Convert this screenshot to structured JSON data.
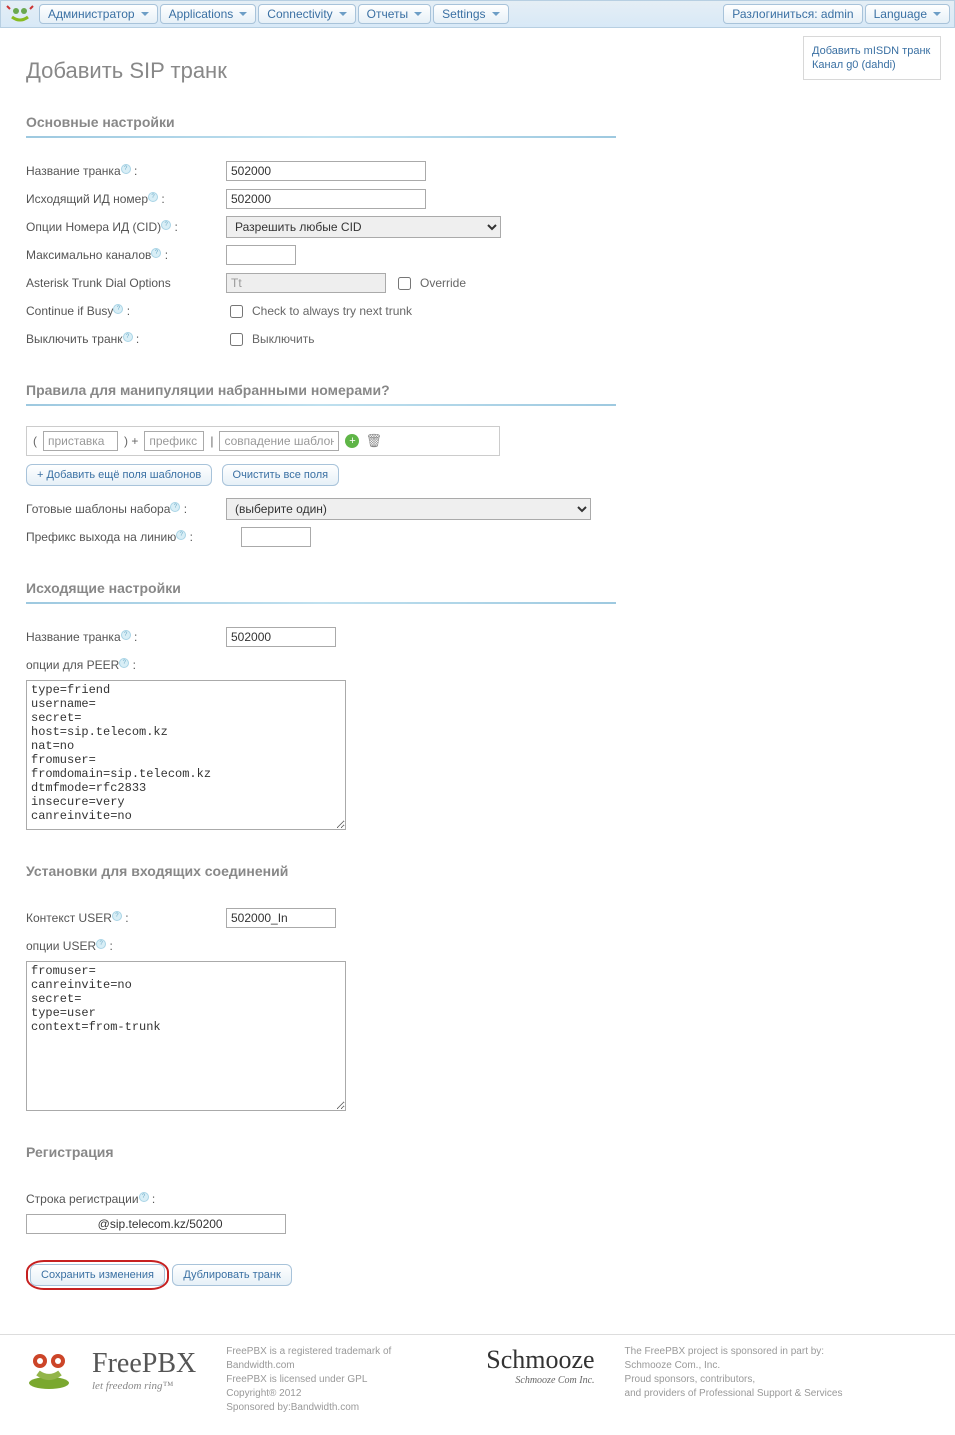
{
  "nav": {
    "admin": "Администратор",
    "apps": "Applications",
    "conn": "Connectivity",
    "reports": "Отчеты",
    "settings": "Settings",
    "logout": "Разлогиниться: admin",
    "language": "Language"
  },
  "side": {
    "misdn": "Добавить mISDN транк",
    "dahdi": "Канал g0 (dahdi)"
  },
  "page": {
    "title": "Добавить SIP транк"
  },
  "sections": {
    "general": "Основные настройки",
    "dialrules": "Правила для манипуляции набранными номерами",
    "outgoing": "Исходящие настройки",
    "incoming": "Установки для входящих соединений",
    "registration": "Регистрация"
  },
  "labels": {
    "trunk_name": "Название транка",
    "outgoing_cid": "Исходящий ИД номер",
    "cid_options": "Опции Номера ИД (CID)",
    "max_channels": "Максимально каналов",
    "dial_options": "Asterisk Trunk Dial Options",
    "override": "Override",
    "continue_busy": "Continue if Busy",
    "continue_busy_chk": "Check to always try next trunk",
    "disable_trunk": "Выключить транк",
    "disable_chk": "Выключить",
    "add_more": "+ Добавить ещё поля шаблонов",
    "clear_all": "Очистить все поля",
    "ready_templates": "Готовые шаблоны набора",
    "out_prefix": "Префикс выхода на линию",
    "trunk_name2": "Название транка",
    "peer_options": "опции для PEER",
    "user_context": "Контекст USER",
    "user_options": "опции USER",
    "reg_string": "Строка регистрации",
    "save": "Сохранить изменения",
    "duplicate": "Дублировать транк"
  },
  "values": {
    "trunk_name": "502000",
    "outgoing_cid": "502000",
    "cid_option_selected": "Разрешить любые CID",
    "max_channels": "",
    "dial_options": "Tt",
    "dial_prepend": "приставка",
    "dial_prefix": "префикс",
    "dial_match": "совпадение шаблона",
    "template_selected": "(выберите один)",
    "out_prefix": "",
    "trunk_name2": "502000",
    "peer_details": "type=friend\nusername=\nsecret=\nhost=sip.telecom.kz\nnat=no\nfromuser=\nfromdomain=sip.telecom.kz\ndtmfmode=rfc2833\ninsecure=very\ncanreinvite=no",
    "user_context": "502000_In",
    "user_details": "fromuser=\ncanreinvite=no\nsecret=\ntype=user\ncontext=from-trunk",
    "reg_string": "                    @sip.telecom.kz/50200"
  },
  "footer": {
    "brand1": "FreePBX",
    "brand1_sub": "let freedom ring™",
    "mid1": "FreePBX is a registered trademark of Bandwidth.com",
    "mid2": "FreePBX is licensed under GPL",
    "mid3": "Copyright® 2012",
    "mid4": "Sponsored by:Bandwidth.com",
    "brand2": "Schmooze",
    "brand2_sub": "Schmooze Com Inc.",
    "r1": "The FreePBX project is sponsored in part by:",
    "r2": "Schmooze Com., Inc.",
    "r3": "Proud sponsors, contributors,",
    "r4": "and providers of Professional Support & Services"
  }
}
